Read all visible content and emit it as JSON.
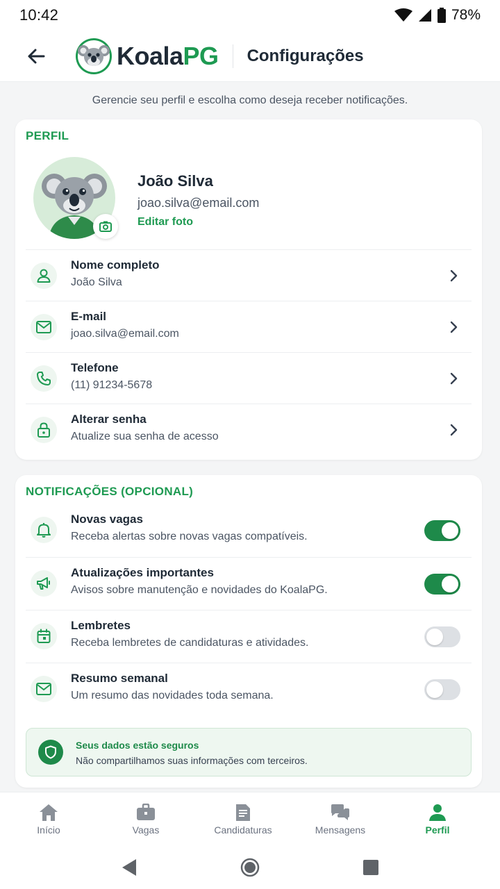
{
  "status_bar": {
    "time": "10:42",
    "battery": "78%"
  },
  "app_bar": {
    "logo_part1": "Koala",
    "logo_part2": "PG",
    "title": "Configurações"
  },
  "subtitle": "Gerencie seu perfil e escolha como deseja receber notificações.",
  "profile": {
    "section_title": "PERFIL",
    "name": "João Silva",
    "email": "joao.silva@email.com",
    "edit_photo": "Editar foto",
    "rows": [
      {
        "label": "Nome completo",
        "value": "João Silva",
        "icon": "user-icon"
      },
      {
        "label": "E-mail",
        "value": "joao.silva@email.com",
        "icon": "mail-icon"
      },
      {
        "label": "Telefone",
        "value": "(11) 91234-5678",
        "icon": "phone-icon"
      },
      {
        "label": "Alterar senha",
        "value": "Atualize sua senha de acesso",
        "icon": "lock-icon"
      }
    ]
  },
  "notifications": {
    "section_title": "NOTIFICAÇÕES (OPCIONAL)",
    "items": [
      {
        "label": "Novas vagas",
        "desc": "Receba alertas sobre novas vagas compatíveis.",
        "enabled": true,
        "icon": "bell-icon"
      },
      {
        "label": "Atualizações importantes",
        "desc": "Avisos sobre manutenção e novidades do KoalaPG.",
        "enabled": true,
        "icon": "megaphone-icon"
      },
      {
        "label": "Lembretes",
        "desc": "Receba lembretes de candidaturas e atividades.",
        "enabled": false,
        "icon": "calendar-icon"
      },
      {
        "label": "Resumo semanal",
        "desc": "Um resumo das novidades toda semana.",
        "enabled": false,
        "icon": "mail-icon"
      }
    ],
    "safe_title": "Seus dados estão seguros",
    "safe_desc": "Não compartilhamos suas informações com terceiros."
  },
  "bottom_nav": [
    {
      "label": "Início",
      "icon": "home-icon",
      "active": false
    },
    {
      "label": "Vagas",
      "icon": "briefcase-icon",
      "active": false
    },
    {
      "label": "Candidaturas",
      "icon": "document-icon",
      "active": false
    },
    {
      "label": "Mensagens",
      "icon": "chat-icon",
      "active": false
    },
    {
      "label": "Perfil",
      "icon": "person-icon",
      "active": true
    }
  ],
  "colors": {
    "accent": "#1e9a52",
    "toggle_on": "#1e8a4a",
    "toggle_off": "#dde0e4"
  }
}
